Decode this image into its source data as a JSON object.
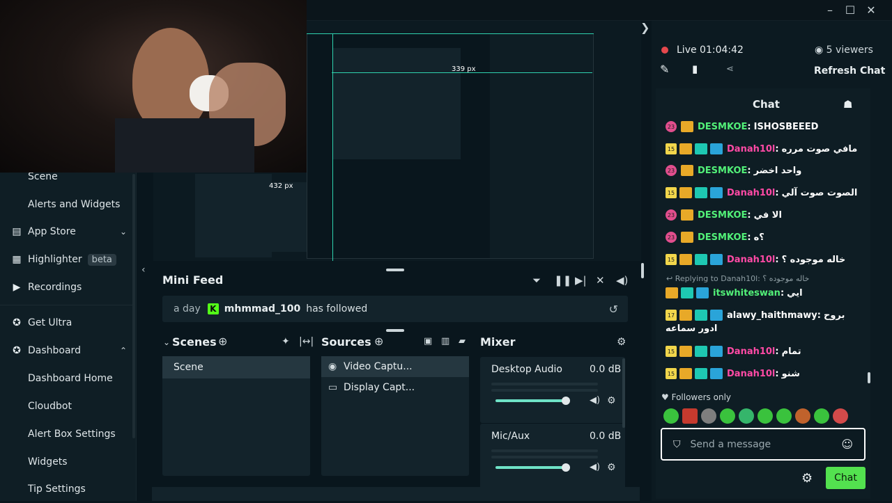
{
  "window": {
    "minimize": "–",
    "maximize": "☐",
    "close": "✕",
    "collapse_arrow": "❯"
  },
  "sidebar": {
    "items": [
      {
        "label": "Scene",
        "icon": "none"
      },
      {
        "label": "Alerts and Widgets",
        "icon": "none"
      },
      {
        "label": "App Store",
        "icon": "store-icon"
      },
      {
        "label": "Highlighter",
        "icon": "highlighter-icon",
        "badge": "beta"
      },
      {
        "label": "Recordings",
        "icon": "play-icon"
      },
      {
        "label": "Get Ultra",
        "icon": "ultra-icon"
      },
      {
        "label": "Dashboard",
        "icon": "dashboard-icon"
      },
      {
        "label": "Dashboard Home"
      },
      {
        "label": "Cloudbot"
      },
      {
        "label": "Alert Box Settings"
      },
      {
        "label": "Widgets"
      },
      {
        "label": "Tip Settings"
      }
    ]
  },
  "preview": {
    "measure_label": "339 px",
    "measure_label_2": "432 px"
  },
  "minifeed": {
    "title": "Mini Feed",
    "event": {
      "time": "a day",
      "platform_icon": "K",
      "user": "mhmmad_100",
      "action": "has followed"
    }
  },
  "scenes": {
    "title": "Scenes",
    "items": [
      "Scene"
    ]
  },
  "sources": {
    "title": "Sources",
    "items": [
      "Video Captu...",
      "Display Capt..."
    ]
  },
  "mixer": {
    "title": "Mixer",
    "tracks": [
      {
        "name": "Desktop Audio",
        "db": "0.0 dB",
        "level": 0.78
      },
      {
        "name": "Mic/Aux",
        "db": "0.0 dB",
        "level": 0.78
      }
    ]
  },
  "stream": {
    "status": "Live",
    "time": "01:04:42",
    "viewers": "5 viewers",
    "refresh": "Refresh Chat"
  },
  "chat": {
    "title": "Chat",
    "messages": [
      {
        "badge": "23",
        "badgeType": "sub",
        "user": "DESMKOE",
        "userColor": "green",
        "text": "ISHOSBEEED"
      },
      {
        "badge": "15",
        "badgeType": "yel",
        "user": "Danah10l",
        "userColor": "pink",
        "text": "مافي صوت مرره"
      },
      {
        "badge": "23",
        "badgeType": "sub",
        "user": "DESMKOE",
        "userColor": "green",
        "text": "واحد اخضر"
      },
      {
        "badge": "15",
        "badgeType": "yel",
        "user": "Danah10l",
        "userColor": "pink",
        "text": "الصوت صوت آلي"
      },
      {
        "badge": "23",
        "badgeType": "sub",
        "user": "DESMKOE",
        "userColor": "green",
        "text": "الا في"
      },
      {
        "badge": "23",
        "badgeType": "sub",
        "user": "DESMKOE",
        "userColor": "green",
        "text": "؟ه"
      },
      {
        "badge": "15",
        "badgeType": "yel",
        "user": "Danah10l",
        "userColor": "pink",
        "text": "خاله موجوده ؟"
      }
    ],
    "reply_context": "Replying to Danah10l: خاله موجوده ؟",
    "messages2": [
      {
        "badge": "",
        "badgeType": "none",
        "user": "itswhiteswan",
        "userColor": "green",
        "text": "ايي"
      },
      {
        "badge": "17",
        "badgeType": "yel",
        "user": "alawy_haithmawy",
        "userColor": "white",
        "text": "بروح"
      },
      {
        "badge": "15",
        "badgeType": "yel",
        "user": "Danah10l",
        "userColor": "pink",
        "text": "تمام"
      },
      {
        "badge": "15",
        "badgeType": "yel",
        "user": "Danah10l",
        "userColor": "pink",
        "text": "شنو"
      }
    ],
    "continuation": "ادور سماعه",
    "followers_only": "Followers only",
    "input_placeholder": "Send a message",
    "send_label": "Chat"
  }
}
